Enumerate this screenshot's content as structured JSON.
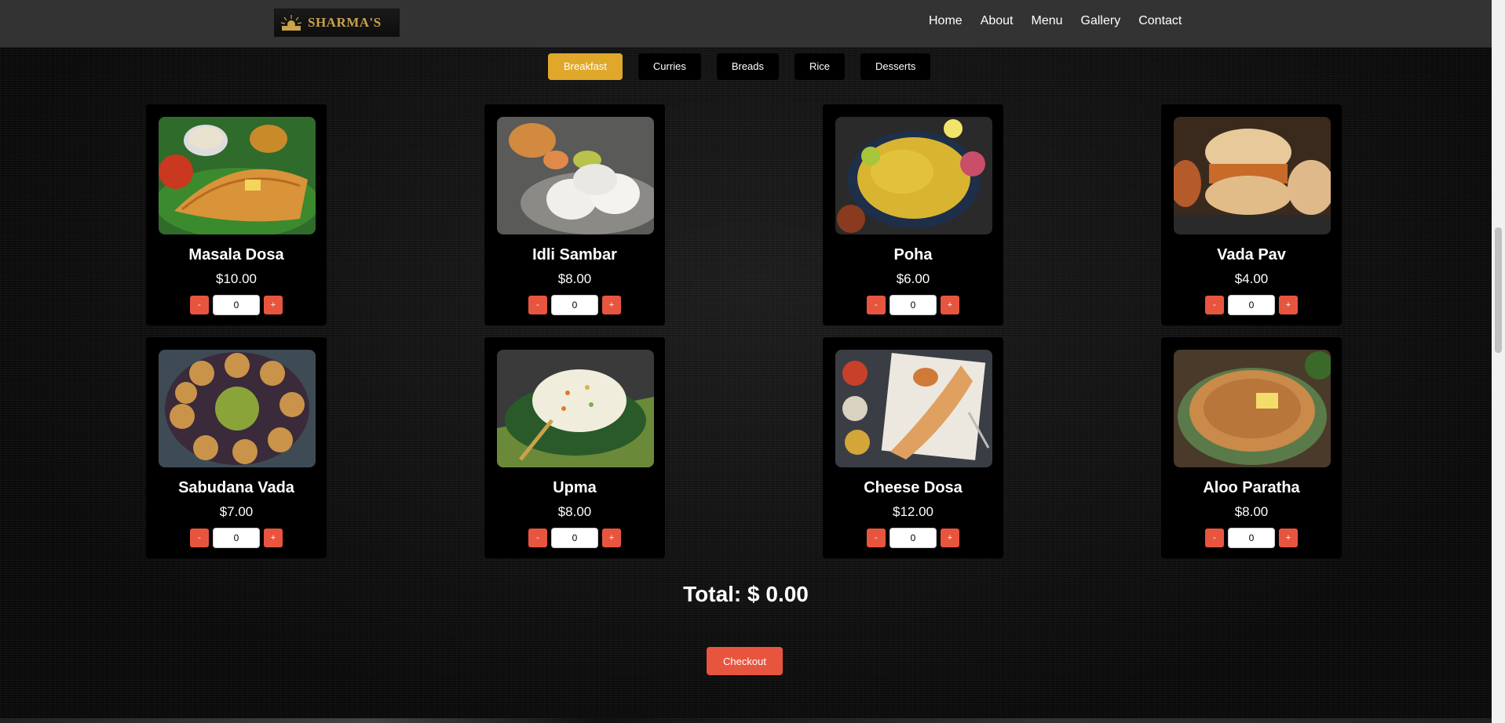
{
  "brand": {
    "logo_text": "SHARMA'S",
    "accent": "#c9a24a"
  },
  "nav": [
    "Home",
    "About",
    "Menu",
    "Gallery",
    "Contact"
  ],
  "tabs": [
    {
      "label": "Breakfast",
      "active": true
    },
    {
      "label": "Curries",
      "active": false
    },
    {
      "label": "Breads",
      "active": false
    },
    {
      "label": "Rice",
      "active": false
    },
    {
      "label": "Desserts",
      "active": false
    }
  ],
  "items": [
    {
      "name": "Masala Dosa",
      "price": "$10.00",
      "qty": "0"
    },
    {
      "name": "Idli Sambar",
      "price": "$8.00",
      "qty": "0"
    },
    {
      "name": "Poha",
      "price": "$6.00",
      "qty": "0"
    },
    {
      "name": "Vada Pav",
      "price": "$4.00",
      "qty": "0"
    },
    {
      "name": "Sabudana Vada",
      "price": "$7.00",
      "qty": "0"
    },
    {
      "name": "Upma",
      "price": "$8.00",
      "qty": "0"
    },
    {
      "name": "Cheese Dosa",
      "price": "$12.00",
      "qty": "0"
    },
    {
      "name": "Aloo Paratha",
      "price": "$8.00",
      "qty": "0"
    }
  ],
  "qty_controls": {
    "minus": "-",
    "plus": "+"
  },
  "total_label": "Total: $ 0.00",
  "checkout_label": "Checkout",
  "colors": {
    "tab_active": "#e0a82a",
    "button": "#e8553f",
    "header": "#333333"
  }
}
